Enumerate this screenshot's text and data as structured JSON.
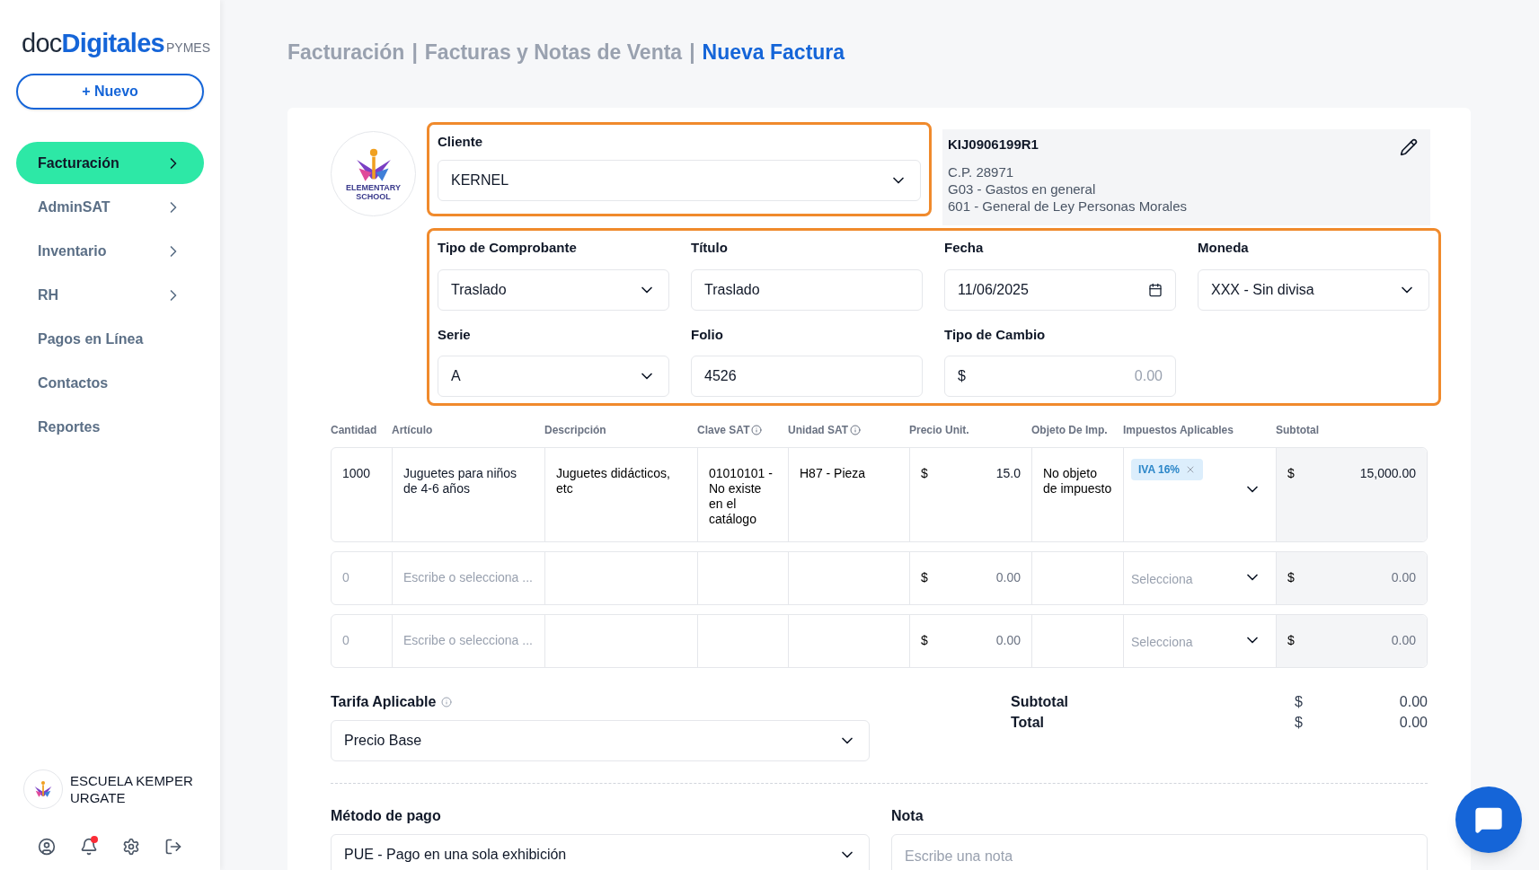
{
  "sidebar": {
    "logo": {
      "doc": "doc",
      "digitales": "Digitales",
      "suffix": "PYMES"
    },
    "new_button": "+ Nuevo",
    "items": [
      {
        "label": "Facturación",
        "selected": true,
        "has_arrow": true
      },
      {
        "label": "AdminSAT",
        "selected": false,
        "has_arrow": true
      },
      {
        "label": "Inventario",
        "selected": false,
        "has_arrow": true
      },
      {
        "label": "RH",
        "selected": false,
        "has_arrow": true
      },
      {
        "label": "Pagos en Línea",
        "selected": false,
        "has_arrow": false
      },
      {
        "label": "Contactos",
        "selected": false,
        "has_arrow": false
      },
      {
        "label": "Reportes",
        "selected": false,
        "has_arrow": false
      }
    ],
    "account": {
      "name": "ESCUELA KEMPER URGATE"
    },
    "notifications_unread": true
  },
  "breadcrumb": [
    {
      "label": "Facturación",
      "current": false
    },
    {
      "label": "Facturas y Notas de Venta",
      "current": false
    },
    {
      "label": "Nueva Factura",
      "current": true
    }
  ],
  "breadcrumb_separator": "|",
  "client": {
    "logo": {
      "line1": "ELEMENTARY",
      "line2": "SCHOOL"
    },
    "label": "Cliente",
    "value": "KERNEL",
    "info": {
      "rfc": "KIJ0906199R1",
      "lines": [
        "C.P. 28971",
        "G03 - Gastos en general",
        "601 - General de Ley Personas Morales"
      ]
    }
  },
  "fields": [
    {
      "label": "Tipo de Comprobante",
      "kind": "select",
      "value": "Traslado"
    },
    {
      "label": "Título",
      "kind": "text",
      "value": "Traslado"
    },
    {
      "label": "Fecha",
      "kind": "date",
      "value": "11/06/2025"
    },
    {
      "label": "Moneda",
      "kind": "select",
      "value": "XXX - Sin divisa"
    },
    {
      "label": "Serie",
      "kind": "select",
      "value": "A"
    },
    {
      "label": "Folio",
      "kind": "text",
      "value": "4526"
    },
    {
      "label": "Tipo de Cambio",
      "kind": "money",
      "prefix": "$",
      "placeholder": "0.00"
    }
  ],
  "table": {
    "columns": [
      {
        "label": "Cantidad",
        "info": false
      },
      {
        "label": "Artículo",
        "info": false
      },
      {
        "label": "Descripción",
        "info": false
      },
      {
        "label": "Clave SAT",
        "info": true
      },
      {
        "label": "Unidad SAT",
        "info": true
      },
      {
        "label": "Precio Unit.",
        "info": false
      },
      {
        "label": "Objeto De Imp.",
        "info": false
      },
      {
        "label": "Impuestos Aplicables",
        "info": false
      },
      {
        "label": "Subtotal",
        "info": false
      }
    ],
    "rows": [
      {
        "kind": "filled",
        "cantidad": "1000",
        "articulo": "Juguetes para niños de 4-6 años",
        "descripcion": "Juguetes didácticos, etc",
        "clave": "01010101 - No existe en el catálogo",
        "unidad": "H87 - Pieza",
        "precio_prefix": "$",
        "precio": "15.0",
        "objeto": "No objeto de impuesto",
        "taxes": [
          "IVA 16%"
        ],
        "subtotal_prefix": "$",
        "subtotal": "15,000.00"
      },
      {
        "kind": "empty",
        "cantidad": "0",
        "articulo": "Escribe o selecciona ...",
        "precio_prefix": "$",
        "precio": "0.00",
        "taxes_placeholder": "Selecciona",
        "subtotal_prefix": "$",
        "subtotal": "0.00"
      },
      {
        "kind": "empty",
        "cantidad": "0",
        "articulo": "Escribe o selecciona ...",
        "precio_prefix": "$",
        "precio": "0.00",
        "taxes_placeholder": "Selecciona",
        "subtotal_prefix": "$",
        "subtotal": "0.00"
      }
    ]
  },
  "tarifa": {
    "label": "Tarifa Aplicable",
    "value": "Precio Base"
  },
  "totals": [
    {
      "label": "Subtotal",
      "prefix": "$",
      "value": "0.00"
    },
    {
      "label": "Total",
      "prefix": "$",
      "value": "0.00"
    }
  ],
  "metodo": {
    "label": "Método de pago",
    "value": "PUE - Pago en una sola exhibición"
  },
  "nota": {
    "label": "Nota",
    "placeholder": "Escribe una nota"
  }
}
